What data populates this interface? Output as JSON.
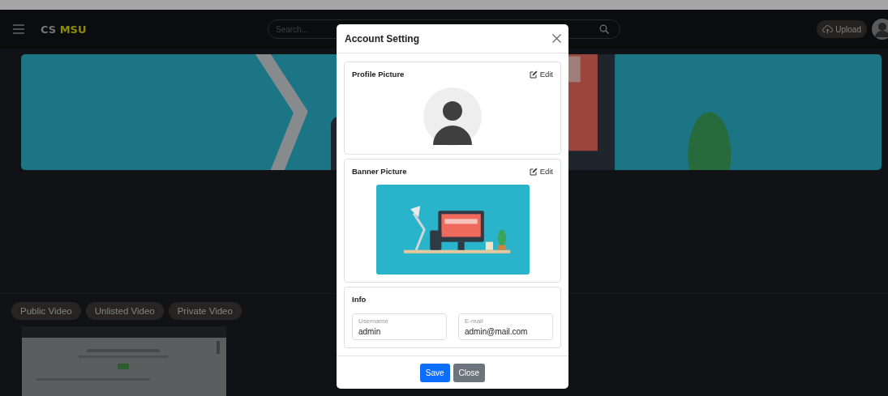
{
  "navbar": {
    "logo": {
      "first": "CS",
      "second": "MSU"
    },
    "search": {
      "placeholder": "Search..."
    },
    "upload_button": "Upload"
  },
  "video_tabs": [
    {
      "label": "Public Video"
    },
    {
      "label": "Unlisted Video"
    },
    {
      "label": "Private Video"
    }
  ],
  "modal": {
    "title": "Account Setting",
    "sections": [
      {
        "kind": "avatar",
        "title": "Profile Picture",
        "edit": "Edit"
      },
      {
        "kind": "banner",
        "title": "Banner Picture",
        "edit": "Edit"
      },
      {
        "kind": "fields",
        "title": "Info",
        "fields": [
          {
            "label": "Username",
            "value": "admin"
          },
          {
            "label": "E-mail",
            "value": "admin@mail.com"
          }
        ]
      }
    ],
    "buttons": [
      {
        "kind": "primary",
        "label": "Save"
      },
      {
        "kind": "secondary",
        "label": "Close"
      }
    ]
  }
}
